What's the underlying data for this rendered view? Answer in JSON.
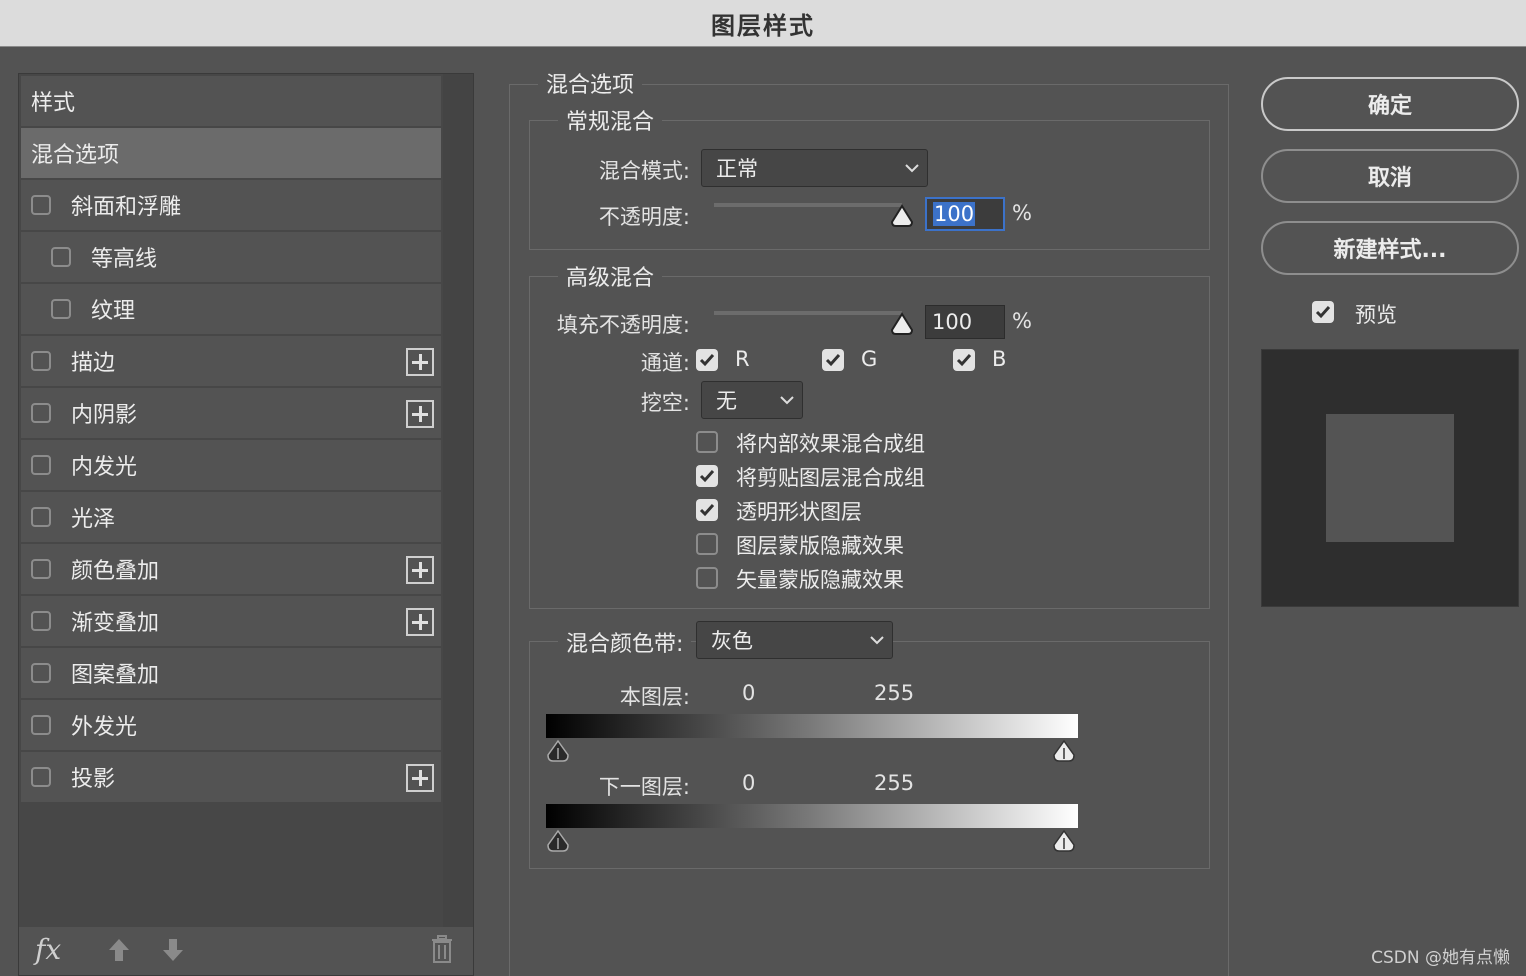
{
  "title": "图层样式",
  "left_panel": {
    "header": "样式",
    "selected": "混合选项",
    "effects": [
      {
        "label": "斜面和浮雕",
        "checked": false,
        "sub": false,
        "plus": false
      },
      {
        "label": "等高线",
        "checked": false,
        "sub": true,
        "plus": false
      },
      {
        "label": "纹理",
        "checked": false,
        "sub": true,
        "plus": false
      },
      {
        "label": "描边",
        "checked": false,
        "sub": false,
        "plus": true
      },
      {
        "label": "内阴影",
        "checked": false,
        "sub": false,
        "plus": true
      },
      {
        "label": "内发光",
        "checked": false,
        "sub": false,
        "plus": false
      },
      {
        "label": "光泽",
        "checked": false,
        "sub": false,
        "plus": false
      },
      {
        "label": "颜色叠加",
        "checked": false,
        "sub": false,
        "plus": true
      },
      {
        "label": "渐变叠加",
        "checked": false,
        "sub": false,
        "plus": true
      },
      {
        "label": "图案叠加",
        "checked": false,
        "sub": false,
        "plus": false
      },
      {
        "label": "外发光",
        "checked": false,
        "sub": false,
        "plus": false
      },
      {
        "label": "投影",
        "checked": false,
        "sub": false,
        "plus": true
      }
    ],
    "footer": {
      "fx_label": "fx"
    }
  },
  "blending": {
    "section_title": "混合选项",
    "general": {
      "title": "常规混合",
      "mode_label": "混合模式:",
      "mode_value": "正常",
      "opacity_label": "不透明度:",
      "opacity_value": "100",
      "opacity_unit": "%",
      "opacity_level": 1.0
    },
    "advanced": {
      "title": "高级混合",
      "fill_label": "填充不透明度:",
      "fill_value": "100",
      "fill_unit": "%",
      "fill_level": 1.0,
      "channels_label": "通道:",
      "channels": [
        {
          "label": "R",
          "checked": true
        },
        {
          "label": "G",
          "checked": true
        },
        {
          "label": "B",
          "checked": true
        }
      ],
      "knockout_label": "挖空:",
      "knockout_value": "无",
      "options": [
        {
          "label": "将内部效果混合成组",
          "checked": false
        },
        {
          "label": "将剪贴图层混合成组",
          "checked": true
        },
        {
          "label": "透明形状图层",
          "checked": true
        },
        {
          "label": "图层蒙版隐藏效果",
          "checked": false
        },
        {
          "label": "矢量蒙版隐藏效果",
          "checked": false
        }
      ]
    },
    "blend_if": {
      "label": "混合颜色带:",
      "value": "灰色",
      "this_layer": {
        "label": "本图层:",
        "low": "0",
        "high": "255"
      },
      "underlying": {
        "label": "下一图层:",
        "low": "0",
        "high": "255"
      }
    }
  },
  "buttons": {
    "ok": "确定",
    "cancel": "取消",
    "new_style": "新建样式...",
    "preview_label": "预览",
    "preview_checked": true
  },
  "watermark": "CSDN @她有点懒"
}
